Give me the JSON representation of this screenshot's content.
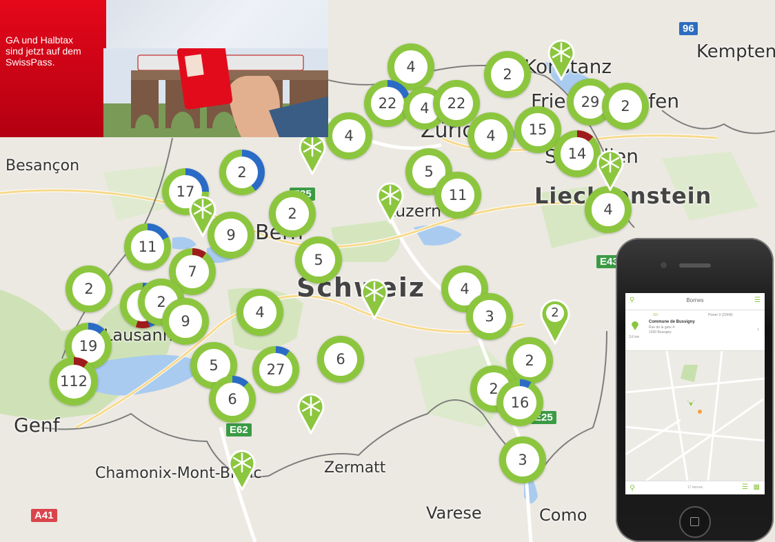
{
  "banner": {
    "lines": [
      "GA und Halbtax",
      "sind jetzt auf dem",
      "SwissPass."
    ],
    "accent": "#e4081a"
  },
  "map": {
    "places": [
      {
        "label": "Besançon"
      },
      {
        "label": "Bern"
      },
      {
        "label": "Schweiz"
      },
      {
        "label": "Luzern"
      },
      {
        "label": "Zürich"
      },
      {
        "label": "Liechtenstein"
      },
      {
        "label": "Konstanz"
      },
      {
        "label": "Friedrichshafen"
      },
      {
        "label": "Kempten"
      },
      {
        "label": "Lausanne"
      },
      {
        "label": "Genf"
      },
      {
        "label": "Chamonix-Mont-Blanc"
      },
      {
        "label": "Zermatt"
      },
      {
        "label": "Varese"
      },
      {
        "label": "Como"
      },
      {
        "label": "St. Gallen"
      }
    ],
    "road_labels": [
      {
        "text": "96",
        "color": "#2d6cc0"
      },
      {
        "text": "E62",
        "color": "#3b9b45"
      },
      {
        "text": "A41",
        "color": "#d9444a"
      },
      {
        "text": "E35",
        "color": "#3b9b45"
      },
      {
        "text": "E43",
        "color": "#3b9b45"
      },
      {
        "text": "E25",
        "color": "#3b9b45"
      }
    ],
    "clusters": [
      {
        "count": "4"
      },
      {
        "count": "2"
      },
      {
        "count": "22"
      },
      {
        "count": "4"
      },
      {
        "count": "22"
      },
      {
        "count": "29"
      },
      {
        "count": "2"
      },
      {
        "count": "4"
      },
      {
        "count": "4"
      },
      {
        "count": "15"
      },
      {
        "count": "14"
      },
      {
        "count": "5"
      },
      {
        "count": "11"
      },
      {
        "count": "4"
      },
      {
        "count": "2"
      },
      {
        "count": "17"
      },
      {
        "count": "2"
      },
      {
        "count": "9"
      },
      {
        "count": "11"
      },
      {
        "count": "7"
      },
      {
        "count": "5"
      },
      {
        "count": "2"
      },
      {
        "count": "5"
      },
      {
        "count": "2"
      },
      {
        "count": "9"
      },
      {
        "count": "4"
      },
      {
        "count": "4"
      },
      {
        "count": "3"
      },
      {
        "count": "19"
      },
      {
        "count": "112"
      },
      {
        "count": "5"
      },
      {
        "count": "27"
      },
      {
        "count": "6"
      },
      {
        "count": "6"
      },
      {
        "count": "2"
      },
      {
        "count": "2"
      },
      {
        "count": "16"
      },
      {
        "count": "3"
      }
    ],
    "pins": [
      {
        "kind": "flower"
      },
      {
        "kind": "flower"
      },
      {
        "kind": "flower"
      },
      {
        "kind": "flower"
      },
      {
        "kind": "flower"
      },
      {
        "kind": "flower"
      },
      {
        "kind": "flower"
      },
      {
        "kind": "number",
        "count": "2"
      }
    ],
    "colors": {
      "green": "#8cc63f",
      "blue": "#2a6bc6",
      "red": "#9e1c1c"
    }
  },
  "phone": {
    "title": "Bornes",
    "status": "3/3",
    "power": "Power 3 (22kW)",
    "station_name": "Commune de Bussigny",
    "address_line1": "Rue de la gare 4",
    "address_line2": "1030 Bussigny",
    "distance": "3.6 km",
    "count": "17 bornes",
    "icons": {
      "search": "search-icon",
      "menu": "menu-icon",
      "pin": "location-pin-icon",
      "list": "list-icon",
      "map": "map-icon"
    }
  }
}
